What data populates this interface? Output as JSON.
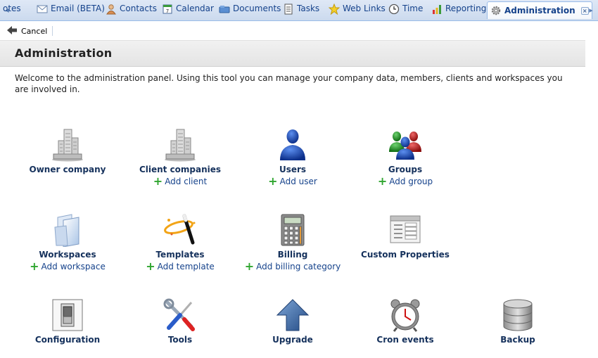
{
  "tabs": [
    {
      "id": "notes",
      "label": "otes",
      "icon": "notes-icon"
    },
    {
      "id": "email",
      "label": "Email (BETA)",
      "icon": "envelope-icon"
    },
    {
      "id": "contacts",
      "label": "Contacts",
      "icon": "contact-icon"
    },
    {
      "id": "calendar",
      "label": "Calendar",
      "icon": "calendar-icon"
    },
    {
      "id": "documents",
      "label": "Documents",
      "icon": "documents-icon"
    },
    {
      "id": "tasks",
      "label": "Tasks",
      "icon": "tasks-icon"
    },
    {
      "id": "weblinks",
      "label": "Web Links",
      "icon": "star-icon"
    },
    {
      "id": "time",
      "label": "Time",
      "icon": "clock-icon"
    },
    {
      "id": "reporting",
      "label": "Reporting",
      "icon": "bar-chart-icon"
    },
    {
      "id": "administration",
      "label": "Administration",
      "icon": "gear-icon",
      "active": true
    }
  ],
  "tab_close_glyph": "×",
  "scroll_left_glyph": "◂",
  "scroll_right_glyph": "▸",
  "toolbar": {
    "cancel_label": "Cancel"
  },
  "page": {
    "title": "Administration",
    "welcome": "Welcome to the administration panel. Using this tool you can manage your company data, members, clients and workspaces you are involved in."
  },
  "plus_glyph": "+",
  "items": {
    "owner_company": {
      "label": "Owner company"
    },
    "client_companies": {
      "label": "Client companies",
      "sub": "Add client"
    },
    "users": {
      "label": "Users",
      "sub": "Add user"
    },
    "groups": {
      "label": "Groups",
      "sub": "Add group"
    },
    "workspaces": {
      "label": "Workspaces",
      "sub": "Add workspace"
    },
    "templates": {
      "label": "Templates",
      "sub": "Add template"
    },
    "billing": {
      "label": "Billing",
      "sub": "Add billing category"
    },
    "custom_properties": {
      "label": "Custom Properties"
    },
    "configuration": {
      "label": "Configuration"
    },
    "tools": {
      "label": "Tools"
    },
    "upgrade": {
      "label": "Upgrade"
    },
    "cron_events": {
      "label": "Cron events"
    },
    "backup": {
      "label": "Backup"
    }
  },
  "colors": {
    "accent": "#15428b",
    "tab_bg": "#cbdaee",
    "add_green": "#2fa52f"
  }
}
